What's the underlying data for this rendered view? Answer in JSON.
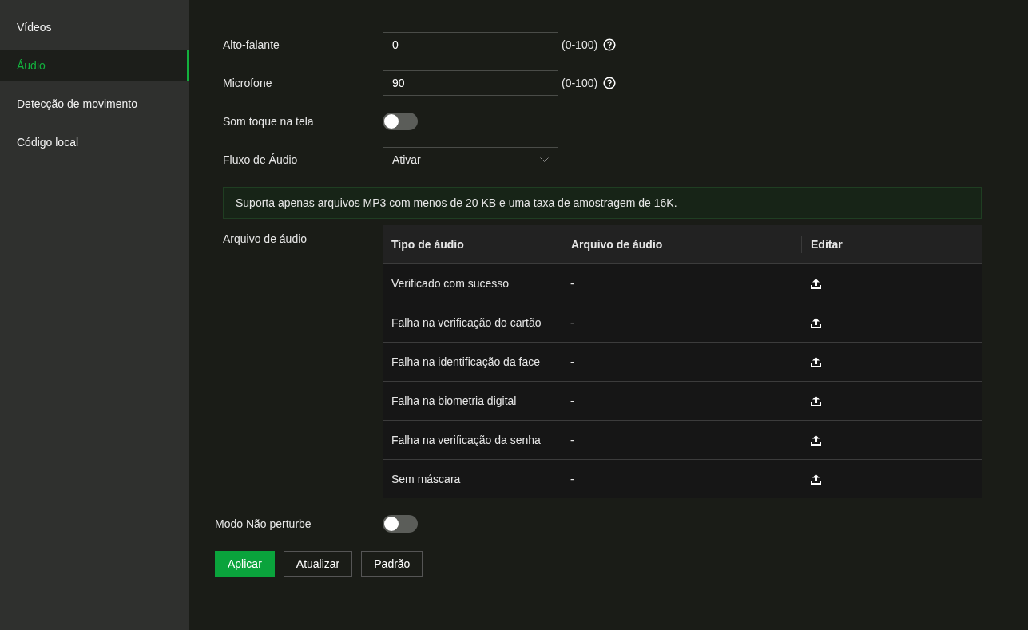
{
  "sidebar": {
    "items": [
      {
        "label": "Vídeos",
        "selected": false
      },
      {
        "label": "Áudio",
        "selected": true
      },
      {
        "label": "Detecção de movimento",
        "selected": false
      },
      {
        "label": "Código local",
        "selected": false
      }
    ]
  },
  "fields": [
    {
      "kind": "number",
      "label": "Alto-falante",
      "value": "0",
      "range": "(0-100)"
    },
    {
      "kind": "number",
      "label": "Microfone",
      "value": "90",
      "range": "(0-100)"
    },
    {
      "kind": "toggle",
      "label": "Som toque na tela",
      "on": false
    },
    {
      "kind": "select",
      "label": "Fluxo de Áudio",
      "value": "Ativar"
    }
  ],
  "note": "Suporta apenas arquivos MP3 com menos de 20 KB e uma taxa de amostragem de 16K.",
  "audio_file": {
    "label": "Arquivo de áudio",
    "columns": [
      "Tipo de áudio",
      "Arquivo de áudio",
      "Editar"
    ],
    "rows": [
      {
        "audio_type": "Verificado com sucesso",
        "audio_file": "-"
      },
      {
        "audio_type": "Falha na verificação do cartão",
        "audio_file": "-"
      },
      {
        "audio_type": "Falha na identificação da face",
        "audio_file": "-"
      },
      {
        "audio_type": "Falha na biometria digital",
        "audio_file": "-"
      },
      {
        "audio_type": "Falha na verificação da senha",
        "audio_file": "-"
      },
      {
        "audio_type": "Sem máscara",
        "audio_file": "-"
      }
    ]
  },
  "do_not_disturb": {
    "label": "Modo Não perturbe",
    "on": false
  },
  "buttons": [
    {
      "label": "Aplicar",
      "kind": "primary"
    },
    {
      "label": "Atualizar",
      "kind": "secondary"
    },
    {
      "label": "Padrão",
      "kind": "secondary"
    }
  ]
}
